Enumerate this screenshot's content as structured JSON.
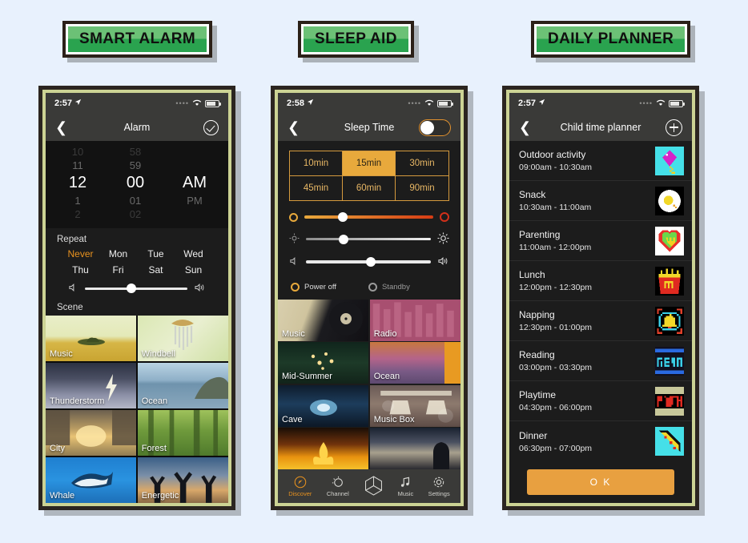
{
  "badges": [
    {
      "label": "SMART ALARM"
    },
    {
      "label": "SLEEP AID"
    },
    {
      "label": "DAILY PLANNER"
    }
  ],
  "colors": {
    "page_background": "#e8f1fd",
    "badge_green_light": "#6cc176",
    "badge_green_dark": "#2aa34f",
    "frame_border": "#ccd394",
    "accent_orange": "#e8a93c",
    "screen_dark": "#1c1c1c"
  },
  "alarm": {
    "status": {
      "time": "2:57",
      "location_icon": "location-arrow",
      "wifi_icon": "wifi",
      "battery_icon": "battery"
    },
    "nav": {
      "back_icon": "chevron-left",
      "title": "Alarm",
      "action_icon": "check-circle"
    },
    "picker": {
      "hours": [
        "10",
        "11",
        "12",
        "1",
        "2"
      ],
      "minutes": [
        "58",
        "59",
        "00",
        "01",
        "02"
      ],
      "meridiem": [
        "AM",
        "PM"
      ],
      "selected_hour": "12",
      "selected_minute": "00",
      "selected_meridiem": "AM"
    },
    "repeat": {
      "label": "Repeat",
      "days": [
        "Never",
        "Mon",
        "Tue",
        "Wed",
        "Thu",
        "Fri",
        "Sat",
        "Sun"
      ],
      "active": "Never"
    },
    "volume": {
      "left_icon": "volume-low",
      "right_icon": "volume-high",
      "value": 45
    },
    "scene": {
      "label": "Scene",
      "tiles": [
        {
          "name": "Music"
        },
        {
          "name": "Windbell"
        },
        {
          "name": "Thunderstorm"
        },
        {
          "name": "Ocean"
        },
        {
          "name": "City"
        },
        {
          "name": "Forest"
        },
        {
          "name": "Whale"
        },
        {
          "name": "Energetic"
        }
      ]
    }
  },
  "sleep": {
    "status": {
      "time": "2:58",
      "location_icon": "location-arrow",
      "wifi_icon": "wifi",
      "battery_icon": "battery"
    },
    "nav": {
      "back_icon": "chevron-left",
      "title": "Sleep Time",
      "action_icon": "toggle-switch",
      "toggle_on": false
    },
    "durations": [
      "10min",
      "15min",
      "30min",
      "45min",
      "60min",
      "90min"
    ],
    "duration_active": "15min",
    "sliders": [
      {
        "name": "color-temperature",
        "left_icon": "circle-warm",
        "right_icon": "circle-cool",
        "value": 30
      },
      {
        "name": "brightness",
        "left_icon": "brightness-low",
        "right_icon": "brightness-high",
        "value": 30
      },
      {
        "name": "volume",
        "left_icon": "volume-low",
        "right_icon": "volume-high",
        "value": 52
      }
    ],
    "radios": [
      {
        "label": "Power off",
        "selected": true
      },
      {
        "label": "Standby",
        "selected": false
      }
    ],
    "tiles": [
      {
        "name": "Music"
      },
      {
        "name": "Radio"
      },
      {
        "name": "Mid-Summer"
      },
      {
        "name": "Ocean"
      },
      {
        "name": "Cave"
      },
      {
        "name": "Music Box"
      },
      {
        "name": ""
      },
      {
        "name": ""
      }
    ],
    "tabs": [
      {
        "label": "Discover",
        "icon": "compass-icon",
        "active": true
      },
      {
        "label": "Channel",
        "icon": "sun-icon",
        "active": false
      },
      {
        "label": "",
        "icon": "hexagon-icon",
        "active": false
      },
      {
        "label": "Music",
        "icon": "music-note-icon",
        "active": false
      },
      {
        "label": "Settings",
        "icon": "gear-icon",
        "active": false
      }
    ]
  },
  "planner": {
    "status": {
      "time": "2:57",
      "location_icon": "location-arrow",
      "wifi_icon": "wifi",
      "battery_icon": "battery"
    },
    "nav": {
      "back_icon": "chevron-left",
      "title": "Child time planner",
      "action_icon": "plus-circle"
    },
    "items": [
      {
        "title": "Outdoor activity",
        "time": "09:00am - 10:30am",
        "thumb": "kite-icon"
      },
      {
        "title": "Snack",
        "time": "10:30am - 11:00am",
        "thumb": "fried-egg-icon"
      },
      {
        "title": "Parenting",
        "time": "11:00am - 12:00pm",
        "thumb": "heart-icon"
      },
      {
        "title": "Lunch",
        "time": "12:00pm - 12:30pm",
        "thumb": "fries-icon"
      },
      {
        "title": "Napping",
        "time": "12:30pm - 01:00pm",
        "thumb": "bell-icon"
      },
      {
        "title": "Reading",
        "time": "03:00pm - 03:30pm",
        "thumb": "read-icon"
      },
      {
        "title": "Playtime",
        "time": "04:30pm - 06:00pm",
        "thumb": "play-icon"
      },
      {
        "title": "Dinner",
        "time": "06:30pm - 07:00pm",
        "thumb": "pizza-icon"
      }
    ],
    "ok_label": "O K"
  }
}
